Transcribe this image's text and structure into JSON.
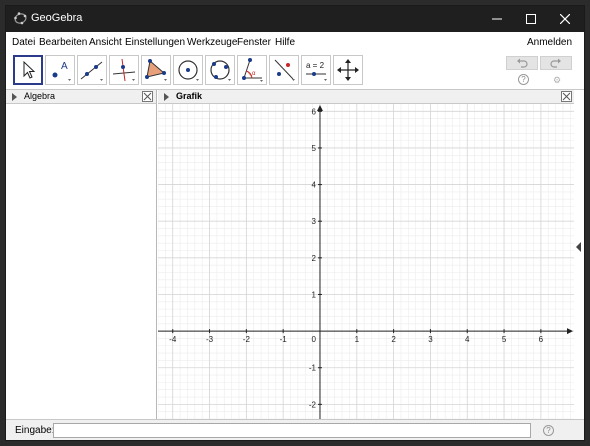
{
  "window": {
    "title": "GeoGebra",
    "menu": [
      "Datei",
      "Bearbeiten",
      "Ansicht",
      "Einstellungen",
      "Werkzeuge",
      "Fenster",
      "Hilfe"
    ],
    "signin": "Anmelden"
  },
  "toolbar": {
    "tools": [
      {
        "name": "move-tool-icon",
        "selected": true
      },
      {
        "name": "point-tool-icon"
      },
      {
        "name": "line-tool-icon"
      },
      {
        "name": "perpendicular-line-tool-icon"
      },
      {
        "name": "polygon-tool-icon"
      },
      {
        "name": "circle-center-point-tool-icon"
      },
      {
        "name": "circle-three-points-tool-icon"
      },
      {
        "name": "angle-tool-icon"
      },
      {
        "name": "reflect-tool-icon"
      },
      {
        "name": "slider-tool-icon",
        "label": "a = 2"
      },
      {
        "name": "move-graphics-view-tool-icon"
      }
    ]
  },
  "algebra": {
    "title": "Algebra"
  },
  "graphics": {
    "title": "Grafik",
    "x_range": [
      -4.4,
      6.9
    ],
    "y_range": [
      -2.4,
      6.2
    ],
    "x_ticks": [
      -4,
      -3,
      -2,
      -1,
      0,
      1,
      2,
      3,
      4,
      5,
      6
    ],
    "y_ticks": [
      -2,
      -1,
      0,
      1,
      2,
      3,
      4,
      5,
      6
    ],
    "grid": true,
    "colors": {
      "major_grid": "#d6d6d6",
      "minor_grid": "#ececec",
      "axis": "#222222"
    }
  },
  "input": {
    "label": "Eingabe:",
    "value": ""
  }
}
